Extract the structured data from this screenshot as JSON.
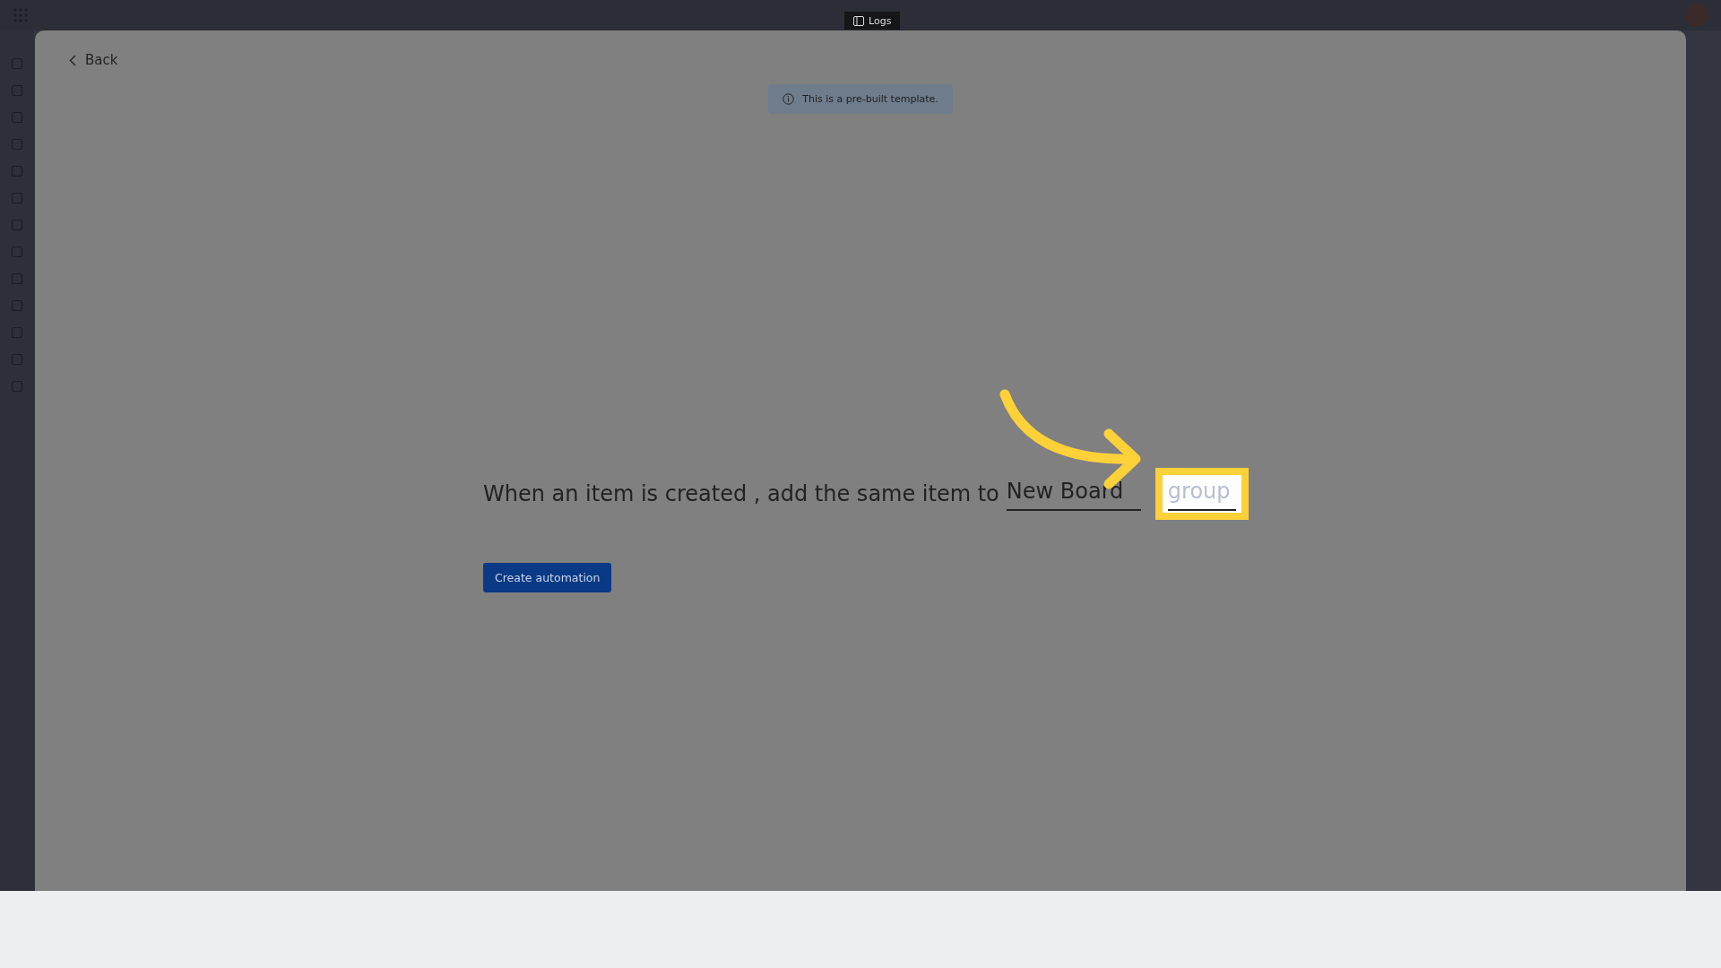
{
  "top_bar": {
    "logs_tab": "Logs"
  },
  "dialog": {
    "back_link": "Back",
    "notice": "This is a pre-built template.",
    "sentence": {
      "text": "When an item is created , add the same item to",
      "board_field": {
        "value": "New Board"
      },
      "group_field": {
        "placeholder": "group"
      }
    },
    "create_button": "Create automation"
  }
}
